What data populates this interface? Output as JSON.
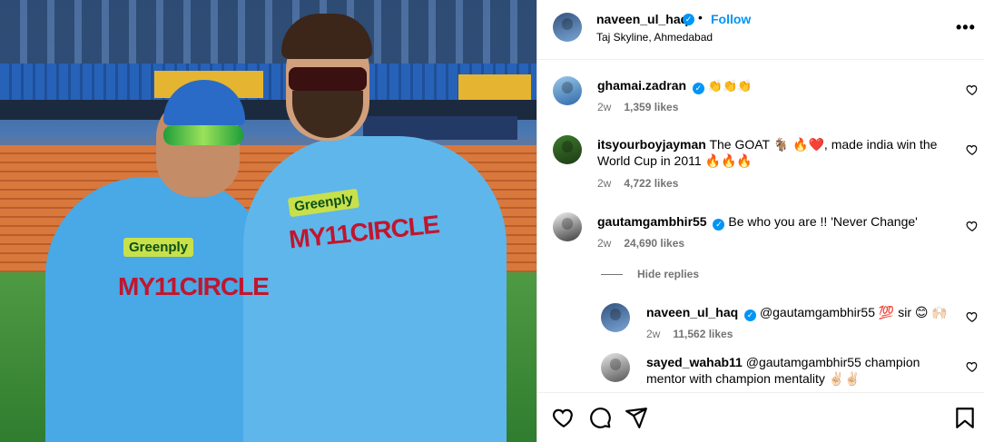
{
  "post": {
    "author": "naveen_ul_haq",
    "follow_label": "Follow",
    "separator": "•",
    "location": "Taj Skyline, Ahmedabad",
    "more_label": "•••"
  },
  "photo": {
    "sponsor_1": "Greenply",
    "sponsor_2": "Greenply",
    "shirt_text_1": "MY11CIRCLE",
    "shirt_text_2": "MY11CIRCLE",
    "verified_mark": "✓"
  },
  "comments": [
    {
      "user": "ghamai.zadran",
      "verified": true,
      "text": "👏👏👏",
      "age": "2w",
      "likes": "1,359 likes"
    },
    {
      "user": "itsyourboyjayman",
      "verified": false,
      "text": "The GOAT 🐐 🔥❤️, made india win the World Cup in 2011 🔥🔥🔥",
      "age": "2w",
      "likes": "4,722 likes"
    },
    {
      "user": "gautamgambhir55",
      "verified": true,
      "text": "Be who you are !! 'Never Change'",
      "age": "2w",
      "likes": "24,690 likes"
    }
  ],
  "hide_replies_label": "Hide replies",
  "replies": [
    {
      "user": "naveen_ul_haq",
      "verified": true,
      "text": "@gautamgambhir55 💯 sir 😊 🙌🏻",
      "age": "2w",
      "likes": "11,562 likes"
    },
    {
      "user": "sayed_wahab11",
      "verified": false,
      "text": "@gautamgambhir55 champion mentor with champion mentality ✌🏻✌🏻"
    }
  ],
  "icons": {
    "like": "heart-icon",
    "comment": "comment-icon",
    "share": "share-icon",
    "save": "bookmark-icon",
    "options": "more-options-icon"
  },
  "colors": {
    "link": "#0095f6",
    "meta": "#737373",
    "border": "#dbdbdb"
  }
}
